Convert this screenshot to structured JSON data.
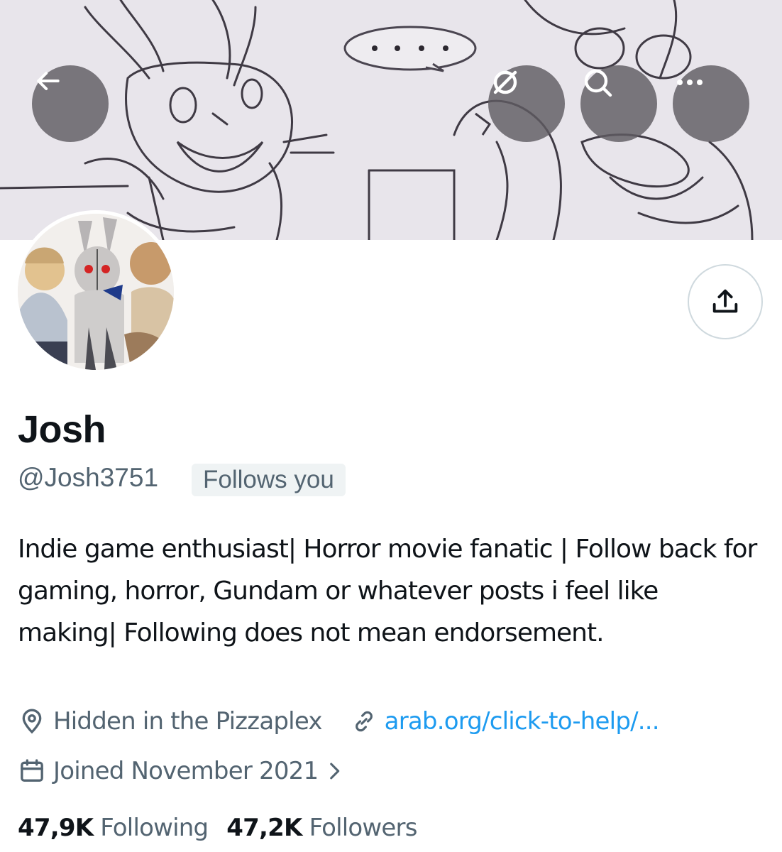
{
  "header": {
    "back_icon": "arrow-left-icon",
    "hide_icon": "eye-slash-icon",
    "search_icon": "search-icon",
    "more_icon": "more-horizontal-icon",
    "banner_caption": "...."
  },
  "profile": {
    "display_name": "Josh",
    "handle": "@Josh3751",
    "follows_you": "Follows you",
    "bio": "Indie game enthusiast| Horror movie fanatic | Follow back for gaming, horror, Gundam or whatever posts i feel like making| Following does not mean endorsement.",
    "location": "Hidden in the Pizzaplex",
    "link": "arab.org/click-to-help/...",
    "joined": "Joined November 2021",
    "share_icon": "share-icon"
  },
  "stats": {
    "following_count": "47,9K",
    "following_label": "Following",
    "followers_count": "47,2K",
    "followers_label": "Followers"
  },
  "colors": {
    "link": "#1d9bf0",
    "secondary_text": "#536471",
    "primary_text": "#0f1419",
    "badge_bg": "#eff3f4"
  }
}
